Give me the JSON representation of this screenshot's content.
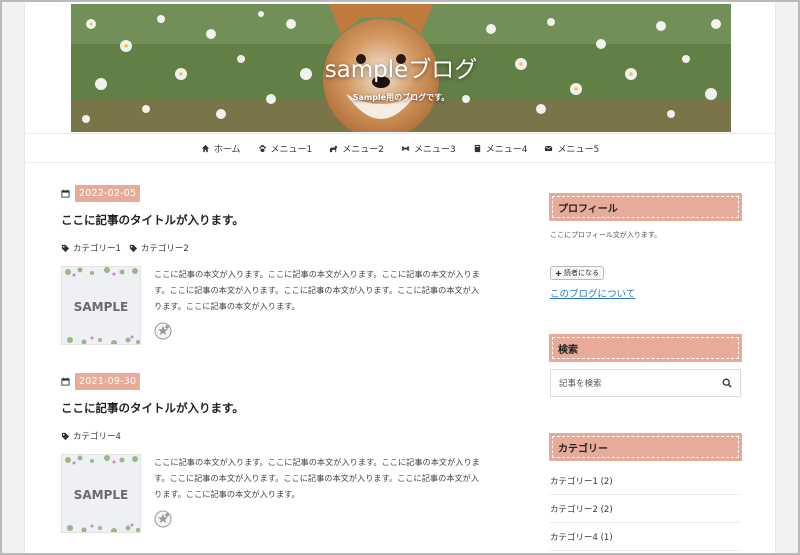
{
  "header": {
    "title": "sampleブログ",
    "description": "Sample用のブログです。"
  },
  "nav": [
    {
      "label": "ホーム",
      "icon": "home-icon"
    },
    {
      "label": "メニュー1",
      "icon": "paw-icon"
    },
    {
      "label": "メニュー2",
      "icon": "dog-icon"
    },
    {
      "label": "メニュー3",
      "icon": "bone-icon"
    },
    {
      "label": "メニュー4",
      "icon": "book-icon"
    },
    {
      "label": "メニュー5",
      "icon": "envelope-icon"
    }
  ],
  "posts": [
    {
      "date": "2022-02-05",
      "title": "ここに記事のタイトルが入ります。",
      "categories": [
        "カテゴリー1",
        "カテゴリー2"
      ],
      "thumb_text": "SAMPLE",
      "excerpt": "ここに記事の本文が入ります。ここに記事の本文が入ります。ここに記事の本文が入ります。ここに記事の本文が入ります。ここに記事の本文が入ります。ここに記事の本文が入ります。ここに記事の本文が入ります。"
    },
    {
      "date": "2021-09-30",
      "title": "ここに記事のタイトルが入ります。",
      "categories": [
        "カテゴリー4"
      ],
      "thumb_text": "SAMPLE",
      "excerpt": "ここに記事の本文が入ります。ここに記事の本文が入ります。ここに記事の本文が入ります。ここに記事の本文が入ります。ここに記事の本文が入ります。ここに記事の本文が入ります。ここに記事の本文が入ります。"
    }
  ],
  "sidebar": {
    "profile_title": "プロフィール",
    "profile_text": "ここにプロフィール文が入ります。",
    "follow_label": "読者になる",
    "about_link": "このブログについて",
    "search_title": "検索",
    "search_placeholder": "記事を検索",
    "category_title": "カテゴリー",
    "categories": [
      "カテゴリー1 (2)",
      "カテゴリー2 (2)",
      "カテゴリー4 (1)"
    ]
  },
  "colors": {
    "accent": "#e8ab9a",
    "link": "#2a78c3"
  }
}
